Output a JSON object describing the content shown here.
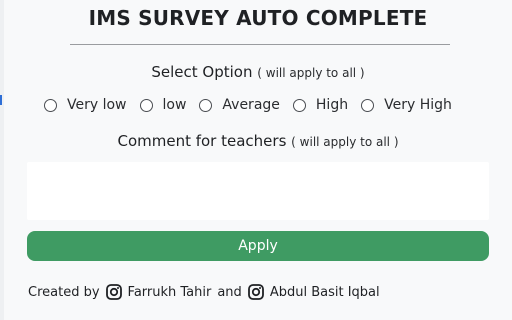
{
  "header": {
    "title": "IMS SURVEY AUTO COMPLETE"
  },
  "select_option": {
    "heading": "Select Option",
    "note": "( will apply to all )",
    "options": [
      "Very low",
      "low",
      "Average",
      "High",
      "Very High"
    ]
  },
  "comment": {
    "heading": "Comment for teachers",
    "note": "( will apply to all )",
    "value": ""
  },
  "apply": {
    "label": "Apply"
  },
  "footer": {
    "created_by": "Created by",
    "and": "and",
    "authors": [
      {
        "name": "Farrukh Tahir",
        "icon": "instagram-icon"
      },
      {
        "name": "Abdul Basit Iqbal",
        "icon": "instagram-icon"
      }
    ]
  },
  "colors": {
    "apply_button": "#3f9b63",
    "popup_background": "#f8f9fa",
    "comment_background": "#ffffff"
  }
}
